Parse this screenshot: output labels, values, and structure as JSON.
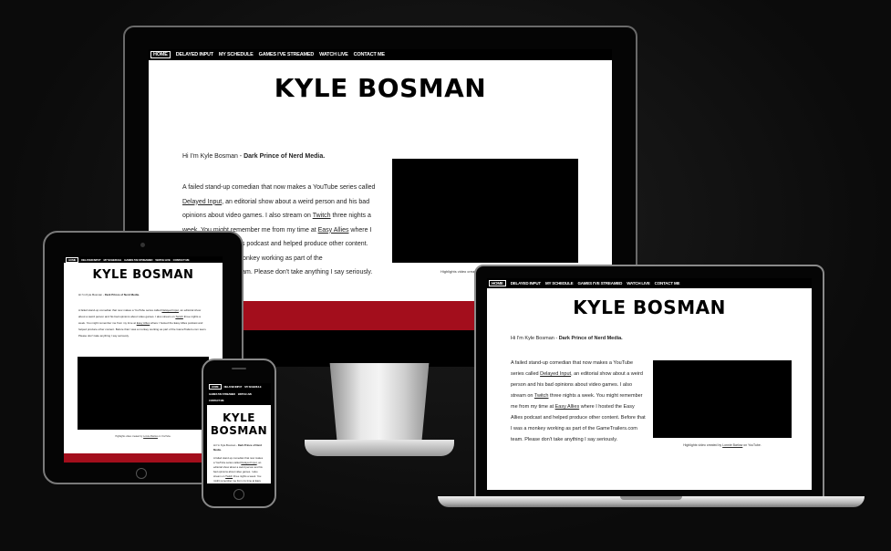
{
  "site": {
    "nav": [
      "HOME",
      "DELAYED INPUT",
      "MY SCHEDULE",
      "GAMES I'VE STREAMED",
      "WATCH LIVE",
      "CONTACT ME"
    ],
    "title": "KYLE BOSMAN",
    "title_line1": "KYLE",
    "title_line2": "BOSMAN",
    "intro_prefix": "Hi I'm Kyle Bosman - ",
    "intro_bold": "Dark Prince of Nerd Media.",
    "body_1": "A failed stand-up comedian that now makes a YouTube series called ",
    "link_delayed": "Delayed Input",
    "body_2": ", an editorial show about a weird person and his bad opinions about video games. I also stream on ",
    "link_twitch": "Twitch",
    "body_3": " three nights a week. You might remember me from my time at ",
    "link_easy": "Easy Allies",
    "body_4": " where I hosted the Easy Allies podcast and helped produce other content. Before that I was a monkey working as part of the GameTrailers.com team. Please don't take anything I say seriously.",
    "caption_prefix": "Highlights video created by ",
    "caption_link": "Lonnie Barlow",
    "caption_suffix": " on YouTube."
  },
  "colors": {
    "accent": "#a30e1c",
    "background": "#111111",
    "nav": "#000000"
  }
}
